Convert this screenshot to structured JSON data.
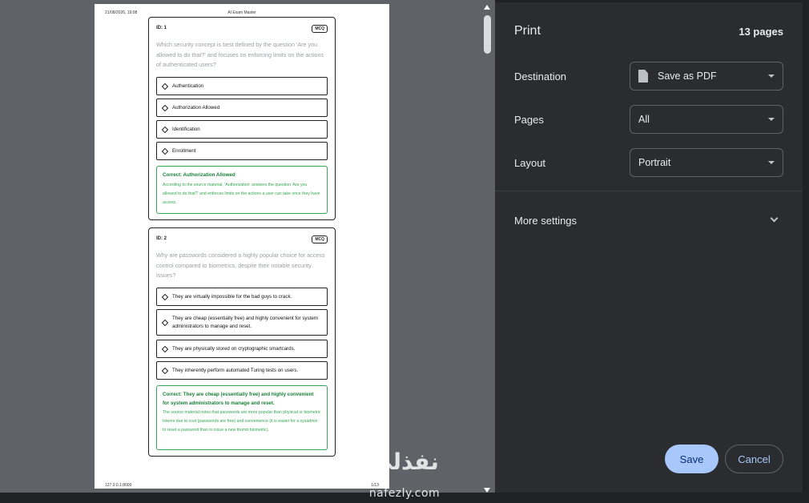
{
  "preview": {
    "header_date": "21/08/2026, 19:08",
    "header_title": "AI Exam Master",
    "footer_url": "127.0.0.1:8000",
    "footer_page": "1/13",
    "questions": [
      {
        "id": "ID: 1",
        "type": "MCQ",
        "text": "Which security concept is best defined by the question 'Are you allowed to do that?' and focuses on enforcing limits on the actions of authenticated users?",
        "options": [
          "Authentication",
          "Authorization Allowed",
          "Identification",
          "Enrollment"
        ],
        "answer_label": "Correct: Authorization Allowed",
        "explanation": "According to the source material, 'Authorization' answers the question 'Are you allowed to do that?' and enforces limits on the actions a user can take once they have access."
      },
      {
        "id": "ID: 2",
        "type": "MCQ",
        "text": "Why are passwords considered a highly popular choice for access control compared to biometrics, despite their notable security issues?",
        "options": [
          "They are virtually impossible for the bad guys to crack.",
          "They are cheap (essentially free) and highly convenient for system administrators to manage and reset.",
          "They are physically stored on cryptographic smartcards.",
          "They inherently perform automated Turing tests on users."
        ],
        "answer_label": "Correct: They are cheap (essentially free) and highly convenient for system administrators to manage and reset.",
        "explanation": "The source material notes that passwords are more popular than physical or biometric tokens due to cost (passwords are free) and convenience (it is easier for a sysadmin to reset a password than to issue a new thumb biometric)."
      }
    ]
  },
  "print": {
    "title": "Print",
    "page_count": "13 pages",
    "destination_label": "Destination",
    "destination_value": "Save as PDF",
    "pages_label": "Pages",
    "pages_value": "All",
    "layout_label": "Layout",
    "layout_value": "Portrait",
    "more_settings": "More settings",
    "save_label": "Save",
    "cancel_label": "Cancel"
  },
  "watermark": {
    "arabic": "نفذلي",
    "latin": "nafezly.com"
  },
  "colors": {
    "accent": "#a8c7fa",
    "sidebar_bg": "#2b2c2f",
    "preview_bg": "#5f6368",
    "correct_green": "#34a853"
  }
}
